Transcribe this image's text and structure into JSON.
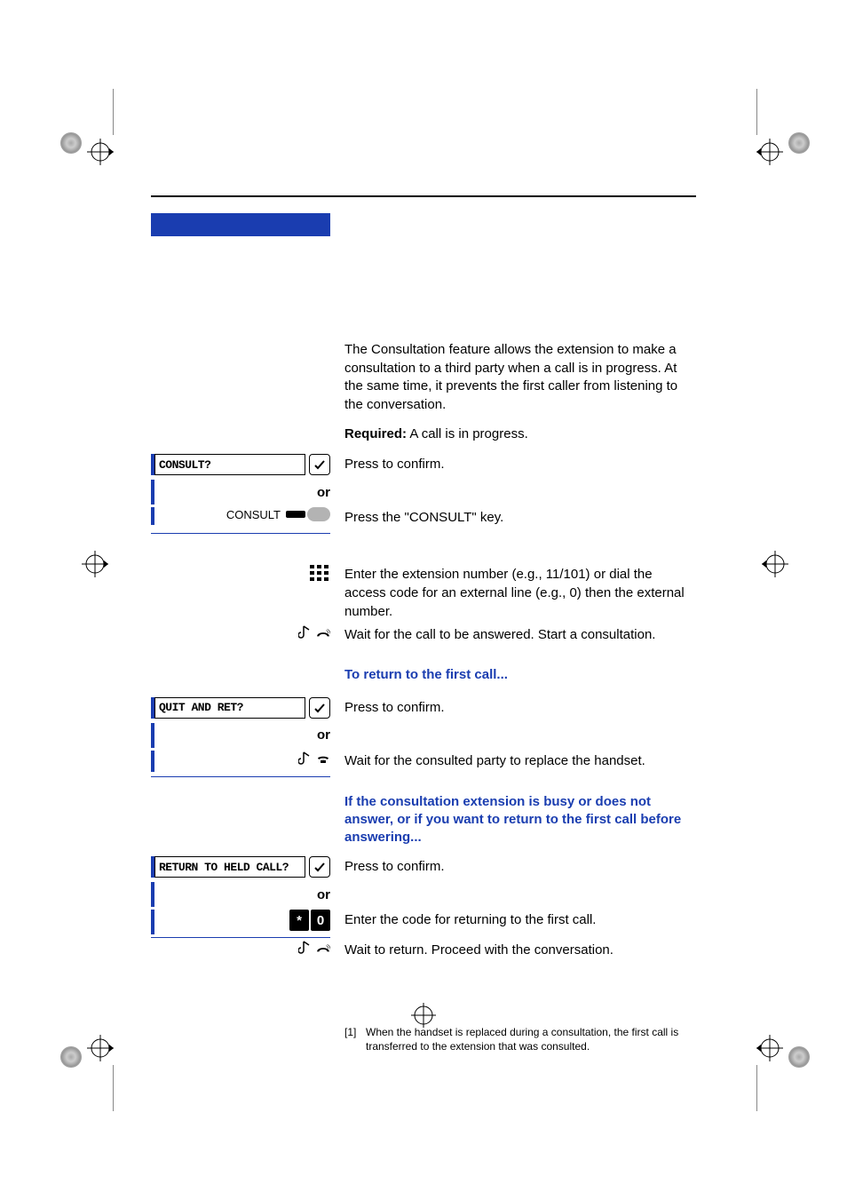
{
  "intro": {
    "paragraph": "The Consultation feature allows the extension to make a consultation to a third party when a call is in progress. At the same time, it prevents the first caller from listening to the conversation.",
    "required_label": "Required:",
    "required_text": " A call is in progress."
  },
  "options": {
    "consult": "CONSULT?",
    "quit": "QUIT AND RET?",
    "return": "RETURN TO HELD CALL?"
  },
  "keys": {
    "consult_label": "CONSULT",
    "or": "or",
    "star": "*",
    "zero": "0"
  },
  "steps": {
    "press_confirm": "Press to confirm.",
    "press_consult": "Press the \"CONSULT\" key.",
    "enter_ext": "Enter the extension number (e.g., 11/101) or dial the access code for an external line (e.g., 0) then the external number.",
    "wait_answered": "Wait for the call to be answered. Start a consultation.",
    "wait_replace": "Wait for the consulted party to replace the handset.",
    "enter_code_return": "Enter the code for returning to the first call.",
    "wait_return": "Wait to return. Proceed with the conversation."
  },
  "subheads": {
    "return_first": "To return to the first call...",
    "busy": "If the consultation extension is busy or does not answer, or if you want to return to the first call before answering..."
  },
  "footnote": {
    "num": "[1]",
    "text": "When the handset is replaced during a consultation, the first call is transferred to the extension that was consulted."
  }
}
